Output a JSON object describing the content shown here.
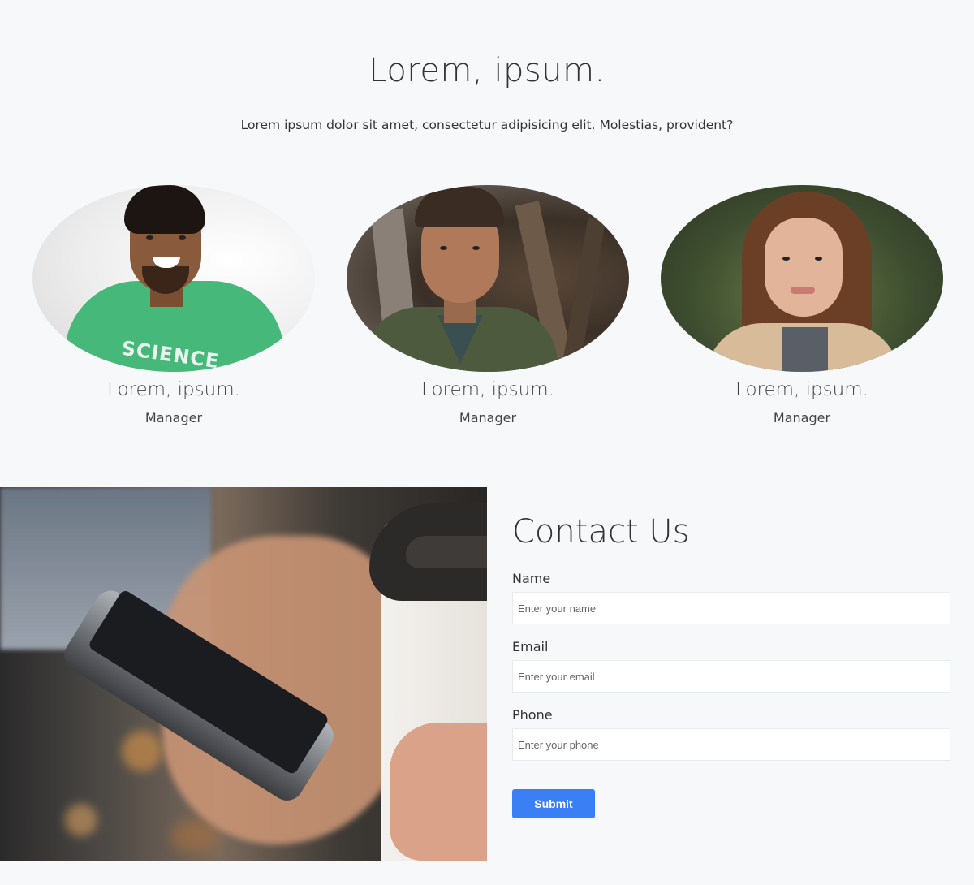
{
  "team": {
    "title": "Lorem, ipsum.",
    "subtitle": "Lorem ipsum dolor sit amet, consectetur adipisicing elit. Molestias, provident?",
    "members": [
      {
        "name": "Lorem, ipsum.",
        "role": "Manager",
        "shirt_text": "SCIENCE"
      },
      {
        "name": "Lorem, ipsum.",
        "role": "Manager"
      },
      {
        "name": "Lorem, ipsum.",
        "role": "Manager"
      }
    ]
  },
  "contact": {
    "title": "Contact Us",
    "fields": {
      "name": {
        "label": "Name",
        "placeholder": "Enter your name"
      },
      "email": {
        "label": "Email",
        "placeholder": "Enter your email"
      },
      "phone": {
        "label": "Phone",
        "placeholder": "Enter your phone"
      }
    },
    "submit_label": "Submit"
  },
  "colors": {
    "background": "#f7f8fa",
    "accent": "#3b7ff4"
  }
}
